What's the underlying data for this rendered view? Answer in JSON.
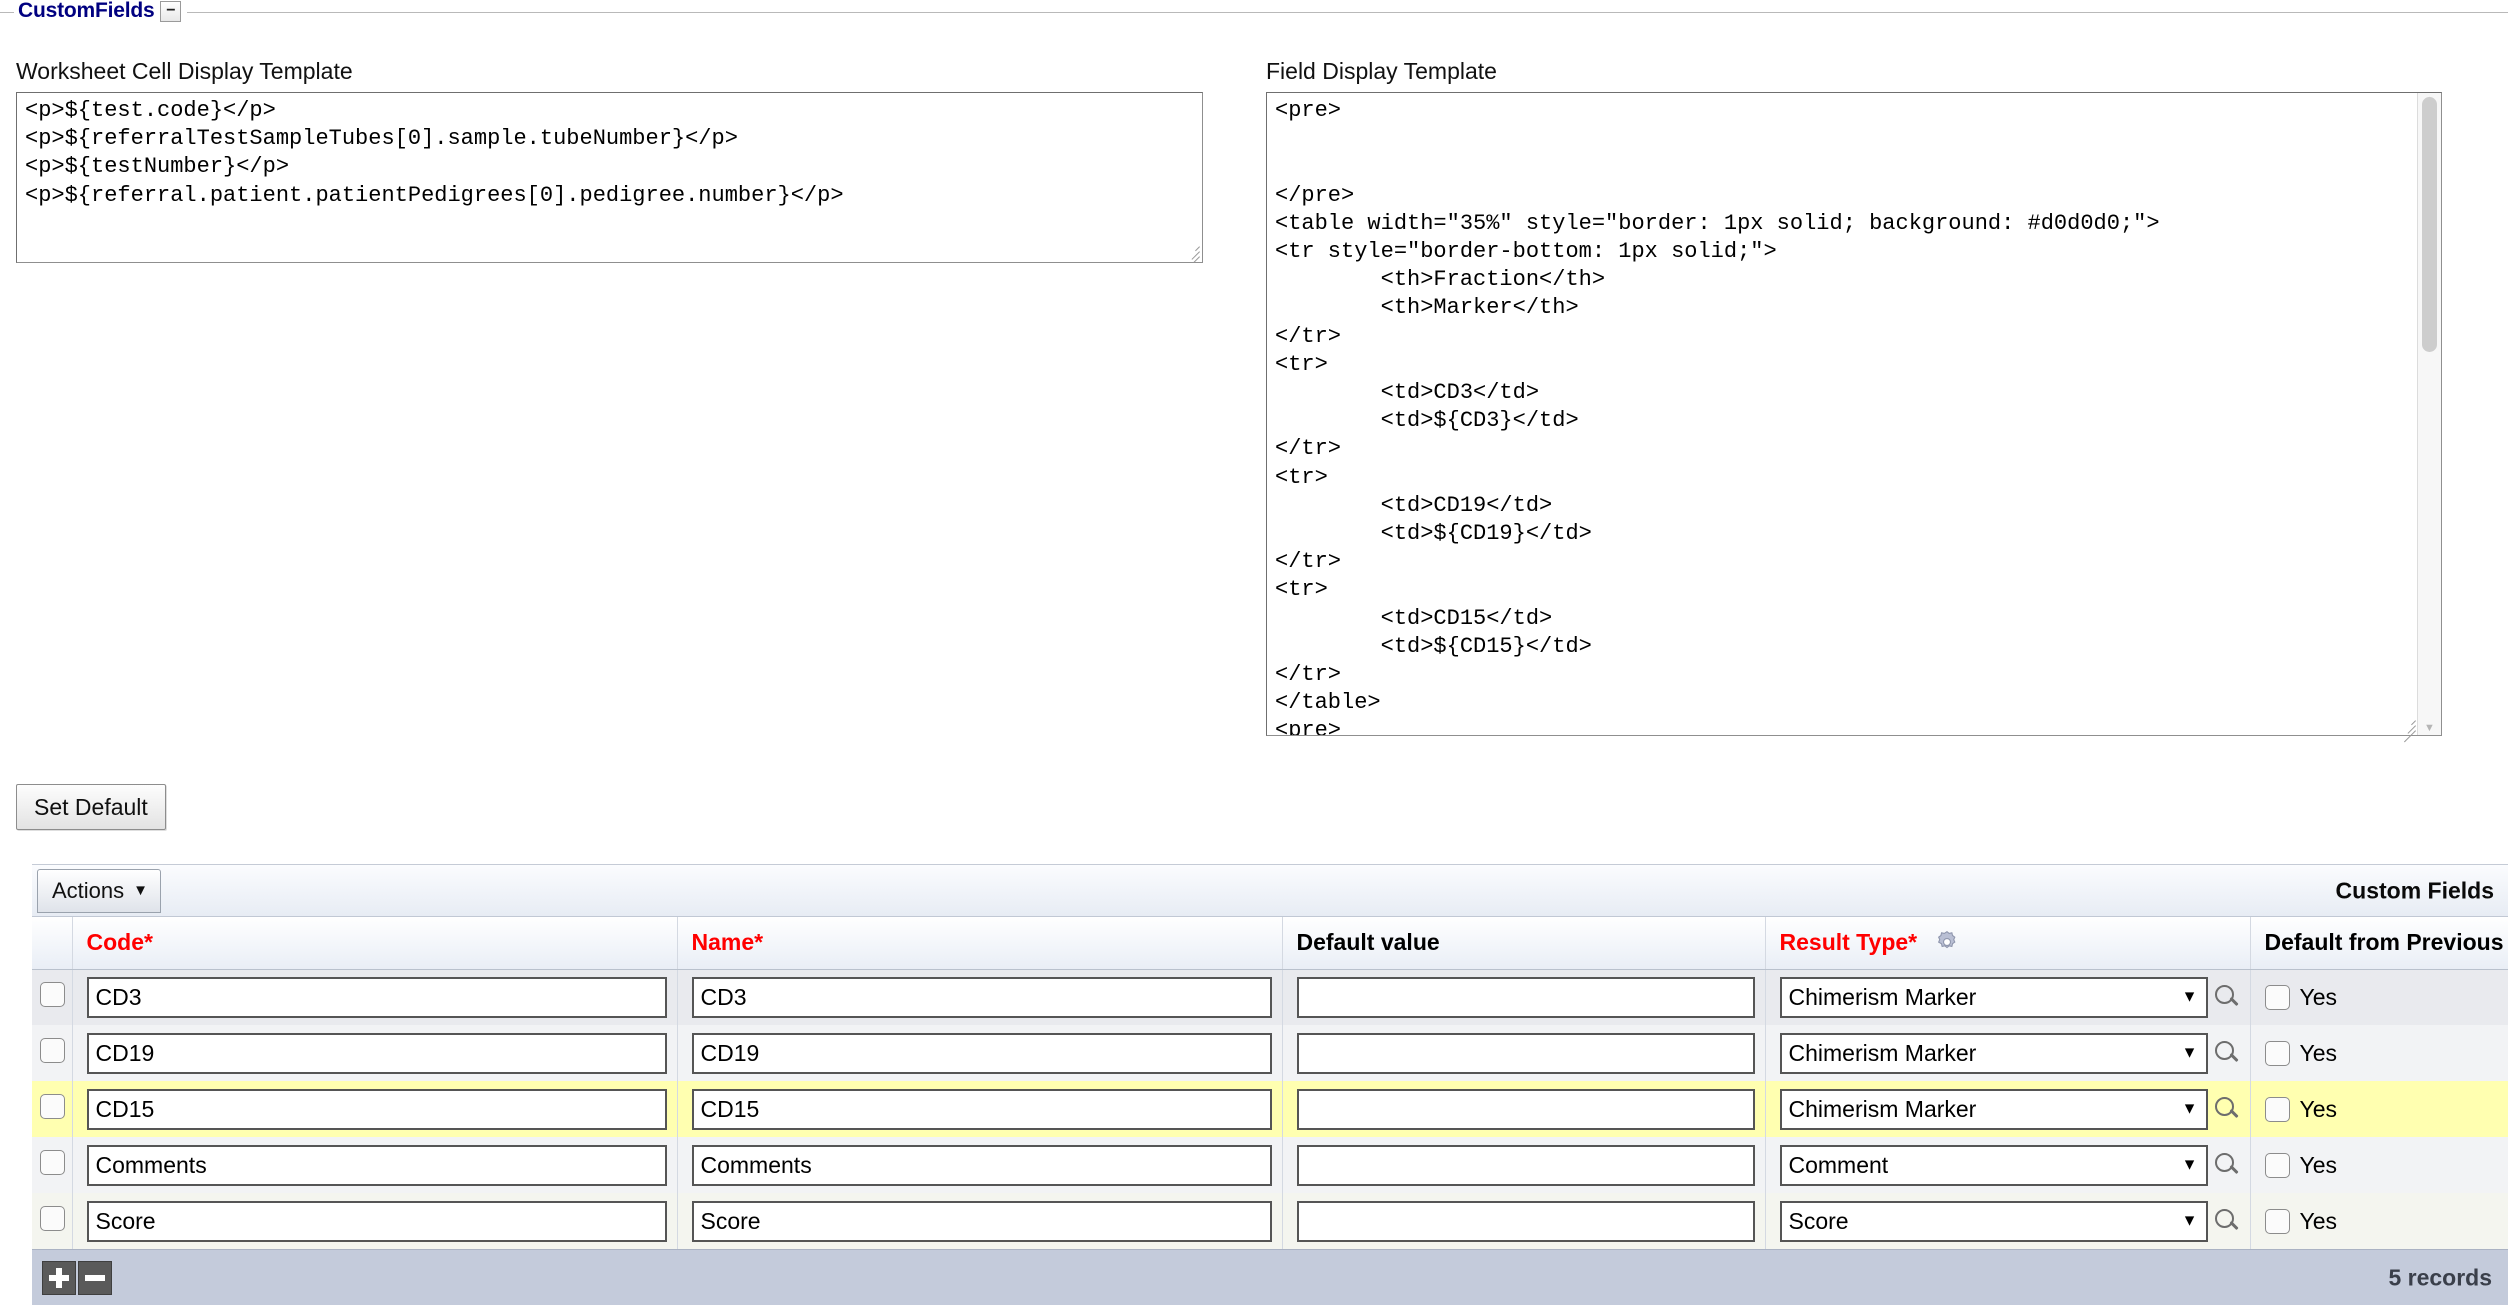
{
  "fieldset": {
    "legend": "CustomFields",
    "toggle_label": "−"
  },
  "templates": {
    "worksheet": {
      "label": "Worksheet Cell Display Template",
      "value": "<p>${test.code}</p>\n<p>${referralTestSampleTubes[0].sample.tubeNumber}</p>\n<p>${testNumber}</p>\n<p>${referral.patient.patientPedigrees[0].pedigree.number}</p>"
    },
    "field": {
      "label": "Field Display Template",
      "value": "<pre>\n\n\n</pre>\n<table width=\"35%\" style=\"border: 1px solid; background: #d0d0d0;\">\n<tr style=\"border-bottom: 1px solid;\">\n        <th>Fraction</th>\n        <th>Marker</th>\n</tr>\n<tr>\n        <td>CD3</td>\n        <td>${CD3}</td>\n</tr>\n<tr>\n        <td>CD19</td>\n        <td>${CD19}</td>\n</tr>\n<tr>\n        <td>CD15</td>\n        <td>${CD15}</td>\n</tr>\n</table>\n<pre>"
    }
  },
  "buttons": {
    "set_default": "Set Default",
    "actions": "Actions",
    "actions_caret": "▼",
    "add_row": "add-row",
    "remove_row": "remove-row"
  },
  "grid": {
    "caption": "Custom Fields",
    "record_count": "5 records",
    "columns": [
      {
        "label": "Code",
        "required": true
      },
      {
        "label": "Name",
        "required": true
      },
      {
        "label": "Default value",
        "required": false
      },
      {
        "label": "Result Type",
        "required": true,
        "has_gear": true
      },
      {
        "label": "Default from Previous",
        "required": false
      }
    ],
    "required_marker": "*",
    "select_caret": "▼",
    "rows": [
      {
        "code": "CD3",
        "name": "CD3",
        "default_value": "",
        "result_type": "Chimerism Marker",
        "default_from_previous_label": "Yes",
        "default_from_previous_checked": false,
        "highlight": false
      },
      {
        "code": "CD19",
        "name": "CD19",
        "default_value": "",
        "result_type": "Chimerism Marker",
        "default_from_previous_label": "Yes",
        "default_from_previous_checked": false,
        "highlight": false
      },
      {
        "code": "CD15",
        "name": "CD15",
        "default_value": "",
        "result_type": "Chimerism Marker",
        "default_from_previous_label": "Yes",
        "default_from_previous_checked": false,
        "highlight": true
      },
      {
        "code": "Comments",
        "name": "Comments",
        "default_value": "",
        "result_type": "Comment",
        "default_from_previous_label": "Yes",
        "default_from_previous_checked": false,
        "highlight": false
      },
      {
        "code": "Score",
        "name": "Score",
        "default_value": "",
        "result_type": "Score",
        "default_from_previous_label": "Yes",
        "default_from_previous_checked": false,
        "highlight": false
      }
    ]
  },
  "colors": {
    "legend": "#000080",
    "required": "#ff0000",
    "row_highlight": "#ffffb0",
    "footer": "#c4cbdb"
  }
}
